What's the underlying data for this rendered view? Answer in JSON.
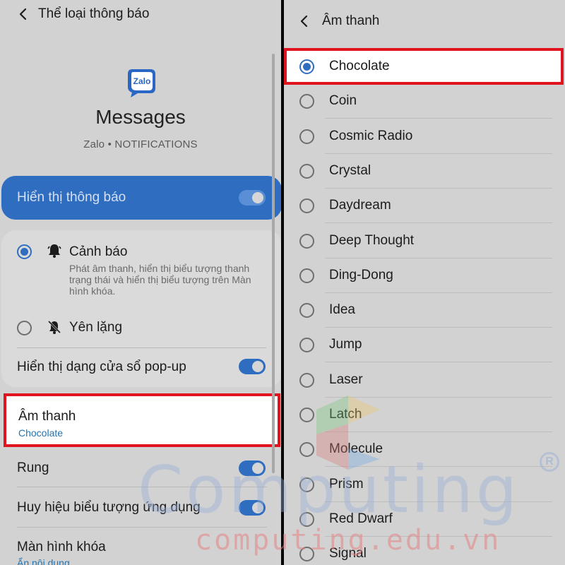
{
  "left": {
    "header": {
      "title": "Thể loại thông báo"
    },
    "app": {
      "logo_text": "Zalo",
      "name": "Messages",
      "subtitle": "Zalo • NOTIFICATIONS"
    },
    "show_notifications": {
      "label": "Hiển thị thông báo",
      "on": true
    },
    "alert_options": [
      {
        "title": "Cảnh báo",
        "desc": "Phát âm thanh, hiển thị biểu tượng thanh trạng thái và hiển thị biểu tượng trên Màn hình khóa.",
        "selected": true,
        "icon": "bell-icon"
      },
      {
        "title": "Yên lặng",
        "selected": false,
        "icon": "bell-off-icon"
      }
    ],
    "popup": {
      "label": "Hiển thị dạng cửa sổ pop-up",
      "on": true
    },
    "sound": {
      "label": "Âm thanh",
      "value": "Chocolate"
    },
    "vibrate": {
      "label": "Rung",
      "on": true
    },
    "badge": {
      "label": "Huy hiệu biểu tượng ứng dụng",
      "on": true
    },
    "lock_screen": {
      "label": "Màn hình khóa",
      "value": "Ẩn nội dung"
    }
  },
  "right": {
    "header": {
      "title": "Âm thanh"
    },
    "selected": "Chocolate",
    "sounds": [
      "Chocolate",
      "Coin",
      "Cosmic Radio",
      "Crystal",
      "Daydream",
      "Deep Thought",
      "Ding-Dong",
      "Idea",
      "Jump",
      "Laser",
      "Latch",
      "Molecule",
      "Prism",
      "Red Dwarf",
      "Signal"
    ]
  },
  "watermark": {
    "main": "Computing",
    "sub": "computing.edu.vn",
    "reg": "R"
  },
  "colors": {
    "accent": "#2f6dc0",
    "highlight": "#e0141e",
    "link": "#2474b0",
    "background": "#d2d2d2"
  }
}
